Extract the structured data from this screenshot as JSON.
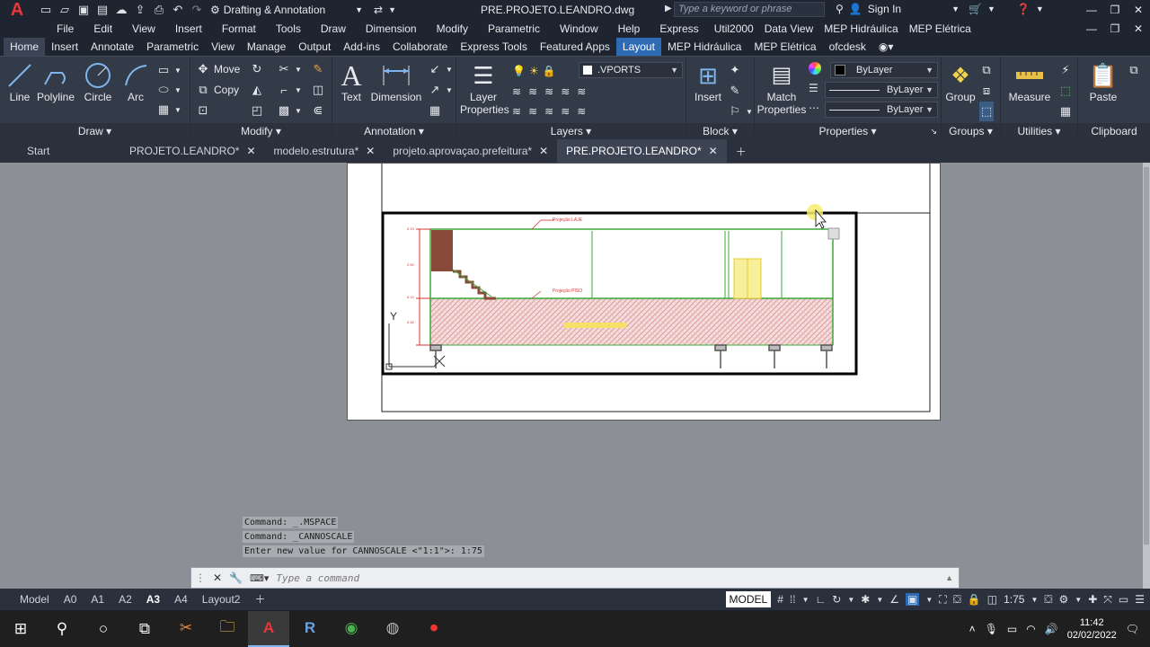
{
  "title_bar": {
    "logo": "A",
    "workspace": "Drafting & Annotation",
    "filename": "PRE.PROJETO.LEANDRO.dwg",
    "search_placeholder": "Type a keyword or phrase",
    "sign_in": "Sign In"
  },
  "menu": [
    "File",
    "Edit",
    "View",
    "Insert",
    "Format",
    "Tools",
    "Draw",
    "Dimension",
    "Modify",
    "Parametric",
    "Window",
    "Help",
    "Express",
    "Util2000",
    "Data View",
    "MEP Hidráulica",
    "MEP Elétrica"
  ],
  "ribbon_tabs": [
    "Home",
    "Insert",
    "Annotate",
    "Parametric",
    "View",
    "Manage",
    "Output",
    "Add-ins",
    "Collaborate",
    "Express Tools",
    "Featured Apps",
    "Layout",
    "MEP Hidráulica",
    "MEP Elétrica",
    "ofcdesk"
  ],
  "ribbon": {
    "draw": {
      "title": "Draw",
      "line": "Line",
      "polyline": "Polyline",
      "circle": "Circle",
      "arc": "Arc"
    },
    "modify": {
      "title": "Modify",
      "move": "Move",
      "copy": "Copy"
    },
    "annotation": {
      "title": "Annotation",
      "text": "Text",
      "dimension": "Dimension"
    },
    "layers": {
      "title": "Layers",
      "layer_properties_1": "Layer",
      "layer_properties_2": "Properties",
      "current_layer": ".VPORTS"
    },
    "block": {
      "title": "Block",
      "insert": "Insert"
    },
    "properties": {
      "title": "Properties",
      "match_1": "Match",
      "match_2": "Properties",
      "color": "ByLayer",
      "linetype": "ByLayer",
      "lineweight": "ByLayer"
    },
    "groups": {
      "title": "Groups",
      "group": "Group"
    },
    "utilities": {
      "title": "Utilities",
      "measure": "Measure"
    },
    "clipboard": {
      "title": "Clipboard",
      "paste": "Paste"
    }
  },
  "doc_tabs": [
    {
      "label": "Start",
      "closable": false,
      "active": false
    },
    {
      "label": "PROJETO.LEANDRO*",
      "closable": true,
      "active": false
    },
    {
      "label": "modelo.estrutura*",
      "closable": true,
      "active": false
    },
    {
      "label": "projeto.aprovaçao.prefeitura*",
      "closable": true,
      "active": false
    },
    {
      "label": "PRE.PROJETO.LEANDRO*",
      "closable": true,
      "active": true
    }
  ],
  "drawing": {
    "labels": {
      "top_note": "Projeção LAJE",
      "bottom_note": "Projeção PISO",
      "dim_1": "0.15",
      "dim_2": "2.50",
      "dim_3": "0.10",
      "dim_4": "0.45",
      "ucs_y": "Y"
    }
  },
  "command_history": [
    "Command: _.MSPACE",
    "Command: _CANNOSCALE",
    "Enter new value for CANNOSCALE <\"1:1\">: 1:75"
  ],
  "command_placeholder": "Type a command",
  "layout_tabs": [
    {
      "label": "Model",
      "active": false
    },
    {
      "label": "A0",
      "active": false
    },
    {
      "label": "A1",
      "active": false
    },
    {
      "label": "A2",
      "active": false
    },
    {
      "label": "A3",
      "active": true
    },
    {
      "label": "A4",
      "active": false
    },
    {
      "label": "Layout2",
      "active": false
    }
  ],
  "status": {
    "space": "MODEL",
    "scale": "1:75"
  },
  "taskbar": {
    "time": "11:42",
    "date": "02/02/2022"
  },
  "colors": {
    "accent": "#2d6cb5",
    "logo": "#e8363c",
    "green_line": "#3aa83a",
    "hatch": "#e7a5a5"
  }
}
